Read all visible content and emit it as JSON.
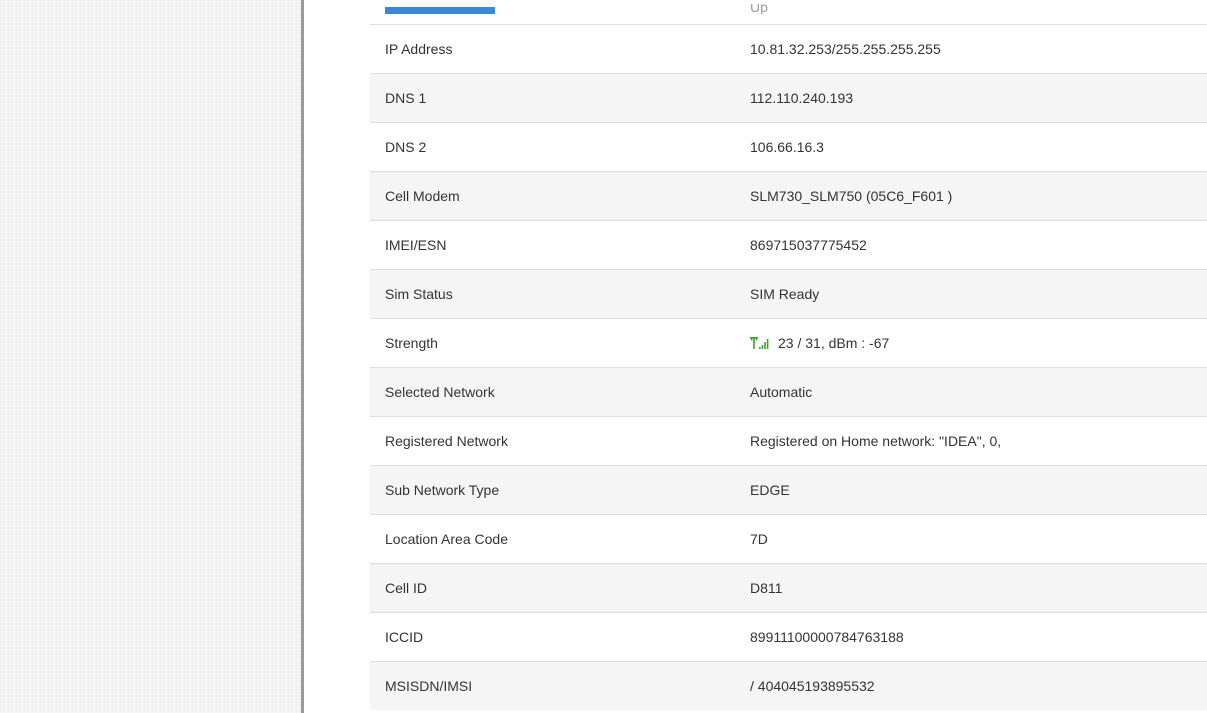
{
  "status": {
    "partial_row": {
      "value": "Up"
    },
    "rows": [
      {
        "label": "IP Address",
        "value": "10.81.32.253/255.255.255.255"
      },
      {
        "label": "DNS 1",
        "value": "112.110.240.193"
      },
      {
        "label": "DNS 2",
        "value": "106.66.16.3"
      },
      {
        "label": "Cell Modem",
        "value": "SLM730_SLM750 (05C6_F601 )"
      },
      {
        "label": "IMEI/ESN",
        "value": "869715037775452"
      },
      {
        "label": "Sim Status",
        "value": "SIM Ready"
      },
      {
        "label": "Strength",
        "value": "23 / 31, dBm : -67",
        "icon": "signal-strength-icon",
        "icon_color": "#3aa52b"
      },
      {
        "label": "Selected Network",
        "value": "Automatic"
      },
      {
        "label": "Registered Network",
        "value": "Registered on Home network: \"IDEA\", 0,"
      },
      {
        "label": "Sub Network Type",
        "value": "EDGE"
      },
      {
        "label": "Location Area Code",
        "value": "7D"
      },
      {
        "label": "Cell ID",
        "value": "D811"
      },
      {
        "label": "ICCID",
        "value": "89911100000784763188"
      },
      {
        "label": "MSISDN/IMSI",
        "value": "/ 404045193895532"
      }
    ]
  },
  "colors": {
    "text": "#333333",
    "stripe": "#f5f5f5",
    "border": "#dddddd",
    "highlight": "#3a86d8"
  }
}
